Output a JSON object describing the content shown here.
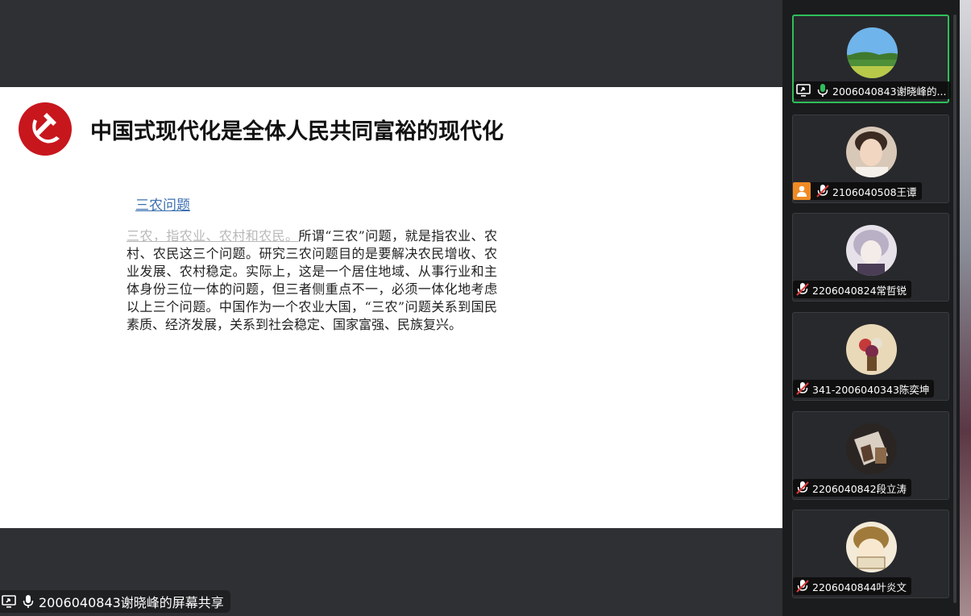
{
  "slide": {
    "title": "中国式现代化是全体人民共同富裕的现代化",
    "link_title": "三农问题",
    "body_lead": "三农，指农业、农村和农民。",
    "body_rest": "所谓“三农”问题，就是指农业、农村、农民这三个问题。研究三农问题目的是要解决农民增收、农业发展、农村稳定。实际上，这是一个居住地域、从事行业和主体身份三位一体的问题，但三者侧重点不一，必须一体化地考虑以上三个问题。中国作为一个农业大国，“三农”问题关系到国民素质、经济发展，关系到社会稳定、国家富强、民族复兴。"
  },
  "share_caption": "2006040843谢晓峰的屏幕共享",
  "participants": [
    {
      "name": "2006040843谢晓峰的...",
      "mic": "on",
      "sharing": true,
      "avatar": "landscape",
      "active": true
    },
    {
      "name": "2106040508王谭",
      "mic": "muted",
      "sharing": false,
      "avatar": "person-a",
      "user_badge": true
    },
    {
      "name": "2206040824常哲锐",
      "mic": "muted",
      "sharing": false,
      "avatar": "anime-a"
    },
    {
      "name": "341-2006040343陈奕坤",
      "mic": "muted",
      "sharing": false,
      "avatar": "flowers"
    },
    {
      "name": "2206040842段立涛",
      "mic": "muted",
      "sharing": false,
      "avatar": "hands"
    },
    {
      "name": "2206040844叶炎文",
      "mic": "muted",
      "sharing": false,
      "avatar": "cartoon"
    }
  ],
  "colors": {
    "active_border": "#2fbf5a",
    "mic_on": "#2fbf5a",
    "emblem_red": "#c8161d",
    "user_badge": "#f08a24"
  }
}
